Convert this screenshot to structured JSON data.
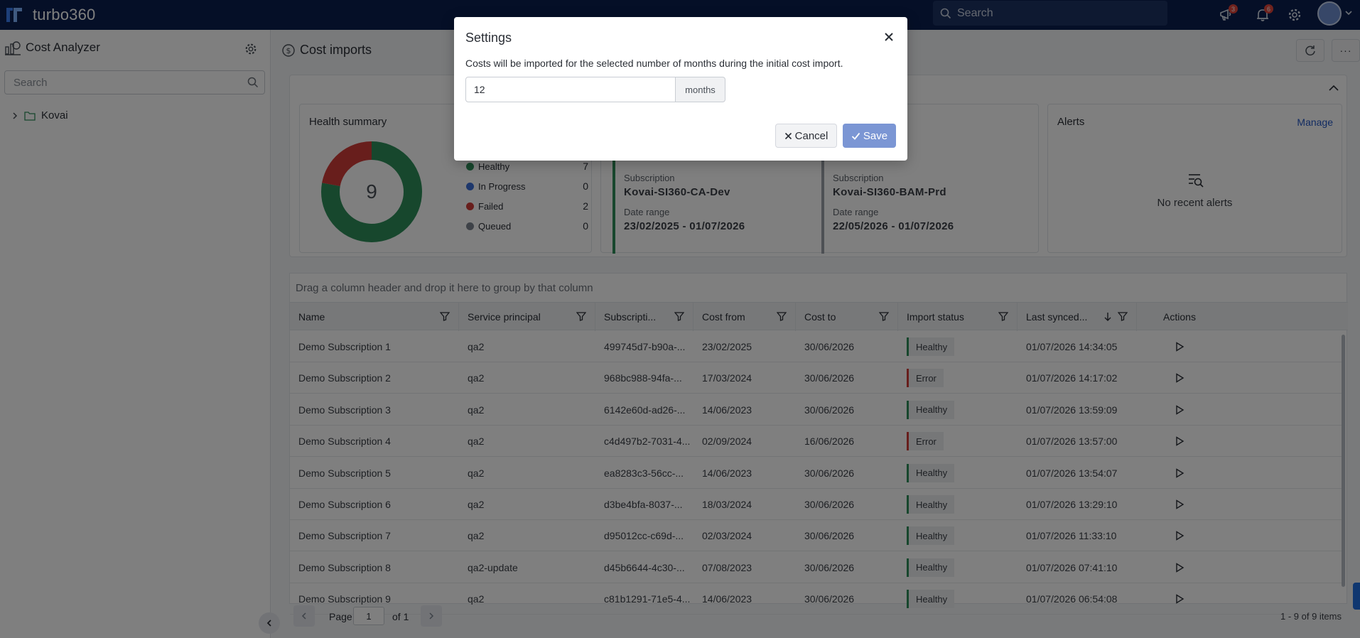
{
  "app": {
    "brand": "turbo360"
  },
  "topbar": {
    "search_placeholder": "Search",
    "announcements_count": "3",
    "notifications_count": "6"
  },
  "sidebar": {
    "title": "Cost Analyzer",
    "search_placeholder": "Search",
    "tree": [
      {
        "label": "Kovai"
      }
    ]
  },
  "main": {
    "title": "Cost imports"
  },
  "health": {
    "title": "Health summary",
    "total": "9",
    "items": [
      {
        "label": "Healthy",
        "value": "7",
        "color": "#2f8f5b"
      },
      {
        "label": "In Progress",
        "value": "0",
        "color": "#3b6fd8"
      },
      {
        "label": "Failed",
        "value": "2",
        "color": "#d13c38"
      },
      {
        "label": "Queued",
        "value": "0",
        "color": "#7d8591"
      }
    ]
  },
  "imports": [
    {
      "subscription_label": "Subscription",
      "subscription": "Kovai-SI360-CA-Dev",
      "range_label": "Date range",
      "range": "23/02/2025 - 01/07/2026"
    },
    {
      "subscription_label": "Subscription",
      "subscription": "Kovai-SI360-BAM-Prd",
      "range_label": "Date range",
      "range": "22/05/2026 - 01/07/2026"
    }
  ],
  "alerts": {
    "title": "Alerts",
    "manage": "Manage",
    "empty": "No recent alerts"
  },
  "grid": {
    "group_hint": "Drag a column header and drop it here to group by that column",
    "columns": [
      "Name",
      "Service principal",
      "Subscripti...",
      "Cost from",
      "Cost to",
      "Import status",
      "Last synced...",
      "Actions"
    ],
    "rows": [
      {
        "name": "Demo Subscription 1",
        "sp": "qa2",
        "sub": "499745d7-b90a-...",
        "from": "23/02/2025",
        "to": "30/06/2026",
        "status": "Healthy",
        "synced": "01/07/2026 14:34:05"
      },
      {
        "name": "Demo Subscription 2",
        "sp": "qa2",
        "sub": "968bc988-94fa-...",
        "from": "17/03/2024",
        "to": "30/06/2026",
        "status": "Error",
        "synced": "01/07/2026 14:17:02"
      },
      {
        "name": "Demo Subscription 3",
        "sp": "qa2",
        "sub": "6142e60d-ad26-...",
        "from": "14/06/2023",
        "to": "30/06/2026",
        "status": "Healthy",
        "synced": "01/07/2026 13:59:09"
      },
      {
        "name": "Demo Subscription 4",
        "sp": "qa2",
        "sub": "c4d497b2-7031-4...",
        "from": "02/09/2024",
        "to": "16/06/2026",
        "status": "Error",
        "synced": "01/07/2026 13:57:00"
      },
      {
        "name": "Demo Subscription 5",
        "sp": "qa2",
        "sub": "ea8283c3-56cc-...",
        "from": "14/06/2023",
        "to": "30/06/2026",
        "status": "Healthy",
        "synced": "01/07/2026 13:54:07"
      },
      {
        "name": "Demo Subscription 6",
        "sp": "qa2",
        "sub": "d3be4bfa-8037-...",
        "from": "18/03/2024",
        "to": "30/06/2026",
        "status": "Healthy",
        "synced": "01/07/2026 13:29:10"
      },
      {
        "name": "Demo Subscription 7",
        "sp": "qa2",
        "sub": "d95012cc-c69d-...",
        "from": "02/03/2024",
        "to": "30/06/2026",
        "status": "Healthy",
        "synced": "01/07/2026 11:33:10"
      },
      {
        "name": "Demo Subscription 8",
        "sp": "qa2-update",
        "sub": "d45b6644-4c30-...",
        "from": "07/08/2023",
        "to": "30/06/2026",
        "status": "Healthy",
        "synced": "01/07/2026 07:41:10"
      },
      {
        "name": "Demo Subscription 9",
        "sp": "qa2",
        "sub": "c81b1291-71e5-4...",
        "from": "14/06/2023",
        "to": "30/06/2026",
        "status": "Healthy",
        "synced": "01/07/2026 06:54:08"
      }
    ]
  },
  "pager": {
    "page_label": "Page",
    "page": "1",
    "of_label": "of 1",
    "items": "1 - 9 of 9 items"
  },
  "dialog": {
    "title": "Settings",
    "description": "Costs will be imported for the selected number of months during the initial cost import.",
    "months_value": "12",
    "unit": "months",
    "cancel": "Cancel",
    "save": "Save"
  }
}
